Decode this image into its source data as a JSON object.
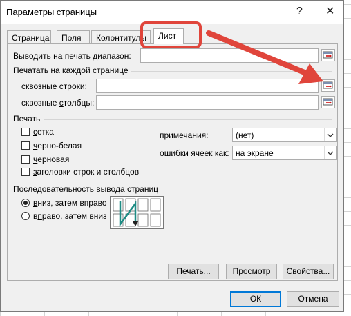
{
  "window": {
    "title": "Параметры страницы",
    "help_symbol": "?",
    "close_symbol": "✕"
  },
  "tabs": [
    {
      "label": "Страница"
    },
    {
      "label": "Поля"
    },
    {
      "label": "Колонтитулы"
    },
    {
      "label": "Лист",
      "active": true
    }
  ],
  "print_area": {
    "label_pre": "Выводить на печать ",
    "label_ul": "д",
    "label_post": "иапазон:",
    "value": ""
  },
  "print_titles": {
    "group_label": "Печатать на каждой странице",
    "rows": {
      "label_pre": "сквозные ",
      "label_ul": "с",
      "label_post": "троки:",
      "value": ""
    },
    "cols": {
      "label_pre": "сквозные ",
      "label_ul": "с",
      "label_post": "толбцы:",
      "value": ""
    }
  },
  "print": {
    "group_label": "Печать",
    "checkboxes": [
      {
        "pre": "",
        "ul": "с",
        "post": "етка",
        "checked": false
      },
      {
        "pre": "",
        "ul": "ч",
        "post": "ерно-белая",
        "checked": false
      },
      {
        "pre": "",
        "ul": "ч",
        "post": "ерновая",
        "checked": false
      },
      {
        "pre": "",
        "ul": "з",
        "post": "аголовки строк и столбцов",
        "checked": false
      }
    ],
    "comments": {
      "label_pre": "приме",
      "label_ul": "ч",
      "label_post": "ания:",
      "value": "(нет)"
    },
    "errors": {
      "label_pre": "о",
      "label_ul": "ш",
      "label_post": "ибки ячеек как:",
      "value": "на экране"
    }
  },
  "page_order": {
    "group_label": "Последовательность вывода страниц",
    "options": [
      {
        "pre": "",
        "ul": "в",
        "post": "низ, затем вправо",
        "selected": true
      },
      {
        "pre": "в",
        "ul": "п",
        "post": "раво, затем вниз",
        "selected": false
      }
    ]
  },
  "buttons": {
    "print": {
      "pre": "",
      "ul": "П",
      "post": "ечать..."
    },
    "preview": {
      "pre": "Прос",
      "ul": "м",
      "post": "отр"
    },
    "options": {
      "pre": "Сво",
      "ul": "й",
      "post": "ства..."
    },
    "ok": "ОК",
    "cancel": "Отмена"
  },
  "colors": {
    "highlight": "#e0453b",
    "accent": "#0078d7",
    "order_arrow": "#1e8c84"
  }
}
